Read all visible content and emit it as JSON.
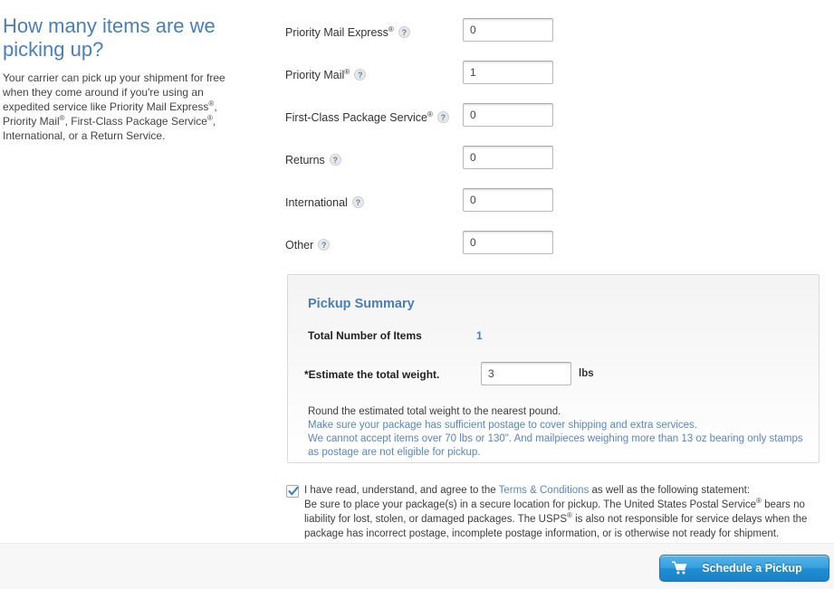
{
  "intro": {
    "title": "How many items are we picking up?",
    "body_part1": "Your carrier can pick up your shipment for free when they come around if you're using an expedited service like Priority Mail Express",
    "body_part2": ", Priority Mail",
    "body_part3": ", First-Class Package Service",
    "body_part4": ", International, or a Return Service.",
    "reg_mark": "®"
  },
  "item_form": {
    "help_icon_glyph": "?",
    "rows": [
      {
        "label": "Priority Mail Express",
        "has_reg": true,
        "value": "0",
        "name": "priority-mail-express"
      },
      {
        "label": "Priority Mail",
        "has_reg": true,
        "value": "1",
        "name": "priority-mail"
      },
      {
        "label": "First-Class Package Service",
        "has_reg": true,
        "value": "0",
        "name": "first-class-package-service"
      },
      {
        "label": "Returns",
        "has_reg": false,
        "value": "0",
        "name": "returns"
      },
      {
        "label": "International",
        "has_reg": false,
        "value": "0",
        "name": "international"
      },
      {
        "label": "Other",
        "has_reg": false,
        "value": "0",
        "name": "other"
      }
    ]
  },
  "summary": {
    "title": "Pickup Summary",
    "total_items_label": "Total Number of Items",
    "total_items_value": "1",
    "weight_label": "*Estimate the total weight.",
    "weight_value": "3",
    "weight_unit": "lbs",
    "note_round": "Round the estimated total weight to the nearest pound.",
    "note_postage": "Make sure your package has sufficient postage to cover shipping and extra services.",
    "note_limits": "We cannot accept items over 70 lbs or 130\". And mailpieces weighing more than 13 oz bearing only stamps as postage are not eligible for pickup."
  },
  "terms": {
    "checked": true,
    "lead_text": "I have read, understand, and agree to the ",
    "link_text": "Terms & Conditions",
    "trail_text": " as well as the following statement:",
    "statement_part1": "Be sure to place your package(s) in a secure location for pickup. The United States Postal Service",
    "statement_part2": " bears no liability for lost, stolen, or damaged packages. The USPS",
    "statement_part3": " is also not responsible for service delays when the package has incorrect postage, incomplete postage information, or is otherwise not ready for shipment.",
    "reg_mark": "®"
  },
  "footer": {
    "submit_label": "Schedule a Pickup"
  },
  "colors": {
    "accent_blue": "#4a7fb5",
    "link_blue": "#5b87bd",
    "button_blue": "#1f8ed2"
  }
}
